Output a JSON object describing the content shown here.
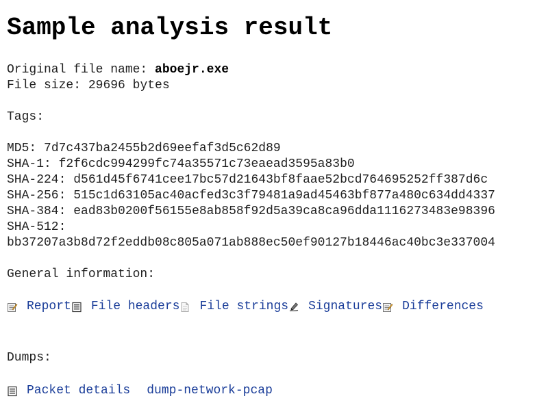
{
  "page": {
    "title": "Sample analysis result"
  },
  "file": {
    "name_label": "Original file name:",
    "name_value": "aboejr.exe",
    "size_label": "File size:",
    "size_value": "29696 bytes"
  },
  "tags": {
    "label": "Tags:"
  },
  "hashes": [
    {
      "label": "MD5:",
      "value": "7d7c437ba2455b2d69eefaf3d5c62d89"
    },
    {
      "label": "SHA-1:",
      "value": "f2f6cdc994299fc74a35571c73eaead3595a83b0"
    },
    {
      "label": "SHA-224:",
      "value": "d561d45f6741cee17bc57d21643bf8faae52bcd764695252ff387d6c"
    },
    {
      "label": "SHA-256:",
      "value": "515c1d63105ac40acfed3c3f79481a9ad45463bf877a480c634dd4337"
    },
    {
      "label": "SHA-384:",
      "value": "ead83b0200f56155e8ab858f92d5a39ca8ca96dda1116273483e98396"
    },
    {
      "label": "SHA-512:",
      "value": "bb37207a3b8d72f2eddb08c805a071ab888ec50ef90127b18446ac40bc3e337004"
    }
  ],
  "general": {
    "label": "General information:",
    "links": [
      {
        "icon": "report-icon",
        "label": "Report"
      },
      {
        "icon": "file-headers-icon",
        "label": "File headers"
      },
      {
        "icon": "file-strings-icon",
        "label": "File strings"
      },
      {
        "icon": "signatures-icon",
        "label": "Signatures"
      },
      {
        "icon": "differences-icon",
        "label": "Differences"
      }
    ]
  },
  "dumps": {
    "label": "Dumps:",
    "links": [
      {
        "icon": "packet-details-icon",
        "label": "Packet details"
      },
      {
        "label": "dump-network-pcap"
      }
    ]
  },
  "colors": {
    "link": "#1a3d99",
    "text": "#222222",
    "title": "#000000"
  }
}
